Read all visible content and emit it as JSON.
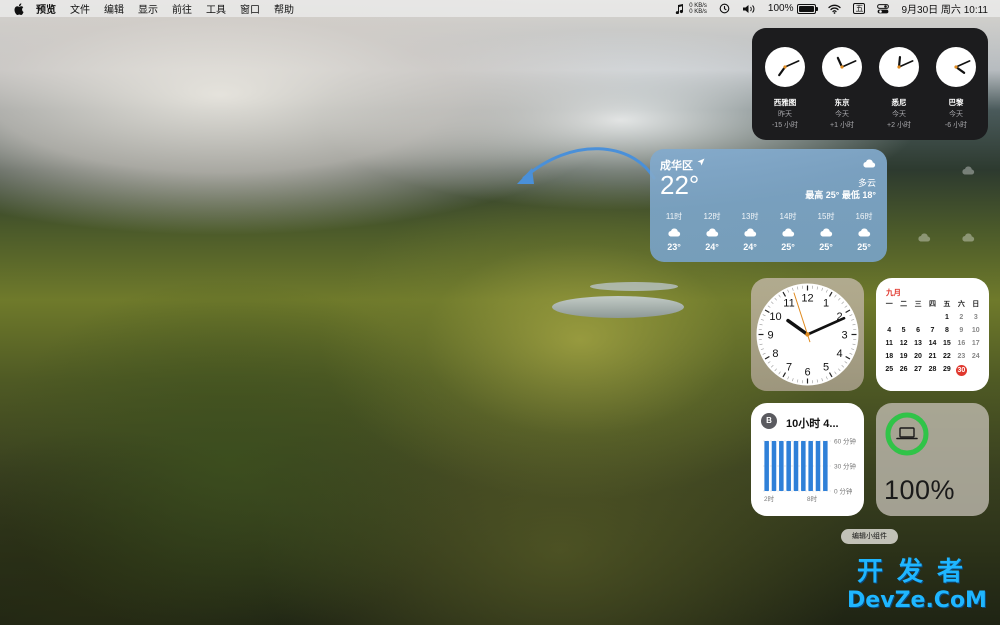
{
  "menubar": {
    "app_name": "预览",
    "menus": [
      "文件",
      "编辑",
      "显示",
      "前往",
      "工具",
      "窗口",
      "帮助"
    ],
    "status": {
      "net_up": "0 KB/s",
      "net_down": "0 KB/s",
      "battery_pct": "100%",
      "input_method": "五",
      "datetime": "9月30日 周六  10:11"
    },
    "icons": [
      "apple-icon",
      "music-icon",
      "time-machine-icon",
      "volume-icon",
      "battery-icon",
      "wifi-icon",
      "control-center-icon"
    ]
  },
  "world_clock": {
    "cities": [
      {
        "name": "西雅图",
        "day": "昨天",
        "offset": "-15 小时",
        "hour": 19,
        "minute": 11
      },
      {
        "name": "东京",
        "day": "今天",
        "offset": "+1 小时",
        "hour": 11,
        "minute": 11
      },
      {
        "name": "悉尼",
        "day": "今天",
        "offset": "+2 小时",
        "hour": 12,
        "minute": 11
      },
      {
        "name": "巴黎",
        "day": "今天",
        "offset": "-6 小时",
        "hour": 4,
        "minute": 11
      }
    ]
  },
  "weather": {
    "city": "成华区",
    "temp": "22°",
    "condition": "多云",
    "hilo": "最高 25° 最低 18°",
    "hours": [
      {
        "h": "11时",
        "t": "23°"
      },
      {
        "h": "12时",
        "t": "24°"
      },
      {
        "h": "13时",
        "t": "24°"
      },
      {
        "h": "14时",
        "t": "25°"
      },
      {
        "h": "15时",
        "t": "25°"
      },
      {
        "h": "16时",
        "t": "25°"
      }
    ]
  },
  "analog_clock": {
    "hour": 10,
    "minute": 11,
    "second": 57
  },
  "calendar": {
    "month": "九月",
    "weekdays": [
      "一",
      "二",
      "三",
      "四",
      "五",
      "六",
      "日"
    ],
    "leading_blanks": 4,
    "days_in_month": 30,
    "today": 30
  },
  "screen_time": {
    "avatar": "B",
    "title": "10小时 4...",
    "y_labels": [
      "60 分钟",
      "30 分钟",
      "0 分钟"
    ],
    "x_labels": [
      "2时",
      "8时"
    ],
    "bar_values": [
      60,
      60,
      60,
      60,
      60,
      60,
      60,
      60,
      60
    ],
    "bar_color": "#2f80d8"
  },
  "battery_widget": {
    "percent": "100%",
    "level": 1.0,
    "ring_color": "#30c448"
  },
  "edit_widgets": {
    "label": "编辑小组件"
  },
  "watermark": {
    "line1": "开发者",
    "line2": "DevZe.CoM"
  }
}
